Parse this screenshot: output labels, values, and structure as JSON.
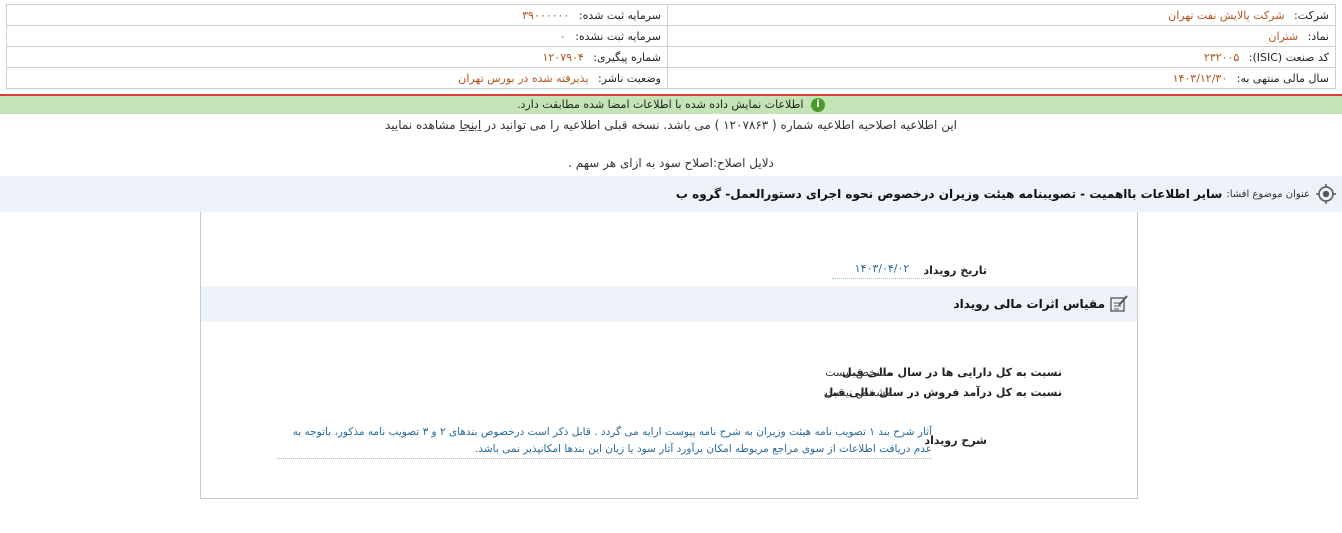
{
  "header": {
    "company_label": "شرکت:",
    "company_value": "شرکت پالایش نفت تهران",
    "symbol_label": "نماد:",
    "symbol_value": "شتران",
    "isic_label": "کد صنعت (ISIC):",
    "isic_value": "۲۳۲۰۰۵",
    "fiscal_year_label": "سال مالی منتهی به:",
    "fiscal_year_value": "۱۴۰۳/۱۲/۳۰",
    "registered_capital_label": "سرمایه ثبت شده:",
    "registered_capital_value": "۳۹۰۰۰۰۰۰",
    "unregistered_capital_label": "سرمایه ثبت نشده:",
    "unregistered_capital_value": "۰",
    "tracking_label": "شماره پیگیری:",
    "tracking_value": "۱۲۰۷۹۰۴",
    "publisher_status_label": "وضعیت ناشر:",
    "publisher_status_value": "پذیرفته شده در بورس تهران"
  },
  "notice": {
    "verification_text": "اطلاعات نمایش داده شده با اطلاعات امضا شده مطابقت دارد.",
    "icon_glyph": "i",
    "correction_before": "این اطلاعیه اصلاحیه اطلاعیه شماره ( ۱۲۰۷۸۶۳ ) می باشد. نسخه قبلی اطلاعیه را می توانید در",
    "correction_link": "اینجا",
    "correction_after": "مشاهده نمایید",
    "reason_text": "دلایل اصلاح:اصلاح سود به ازای هر سهم ."
  },
  "subject": {
    "label": "عنوان موضوع افشا:",
    "title": "سایر اطلاعات بااهمیت - تصویبنامه هیئت وزیران درخصوص نحوه اجرای دستورالعمل- گروه ب"
  },
  "event": {
    "date_label": "تاریخ رویداد",
    "date_value": "۱۴۰۳/۰۴/۰۲",
    "section_title": "مقیاس اثرات مالی رویداد",
    "ratio_assets_label": "نسبت به کل دارایی ها در سال مالی قبل",
    "ratio_assets_value": "مشخص نیست",
    "ratio_revenue_label": "نسبت به کل درآمد فروش در سال مالی قبل",
    "ratio_revenue_value": "مشخص نیست",
    "description_label": "شرح رویداد",
    "description_value": "آثار شرح بند ۱ تصویب نامه هیئت وزیران به شرح نامه پیوست ارایه می گردد . قابل ذکر است درخصوص بندهای ۲ و ۳ تصویب نامه مذکور، باتوجه به عدم دریافت اطلاعات از سوی مراجع مربوطه امکان برآورد آثار سود یا زیان این بندها امکانپذیر نمی باشد."
  },
  "colors": {
    "value_orange": "#b3541e",
    "verify_green": "#c5e4b6",
    "alert_red": "#e13b3b",
    "desc_blue": "#2a6a9a"
  }
}
